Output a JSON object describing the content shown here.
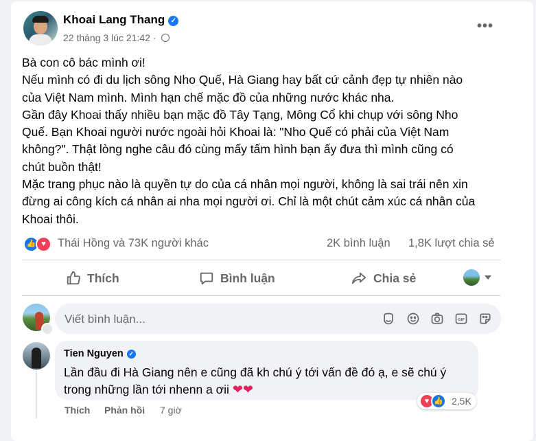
{
  "post": {
    "author": "Khoai Lang Thang",
    "timestamp": "22 tháng 3 lúc 21:42 ·",
    "privacy_icon": "globe-icon",
    "more_label": "•••",
    "lines": [
      "Bà con cô bác mình ơi!",
      "Nếu mình có đi du lịch sông Nho Quế, Hà Giang hay bất cứ cảnh đẹp tự nhiên nào",
      "của Việt Nam mình. Mình hạn chế mặc đồ của những nước khác nha.",
      "Gần đây Khoai thấy nhiều bạn mặc đồ Tây Tạng, Mông Cổ khi chụp với sông Nho",
      "Quế. Bạn Khoai người nước ngoài hỏi Khoai là: \"Nho Quế có phải của Việt Nam",
      "không?\". Thật lòng nghe câu đó cùng mấy tấm hình bạn ấy đưa thì mình cũng có",
      "chút buồn thật!",
      "Mặc trang phục nào là quyền tự do của cá nhân mọi người, không là sai trái nên xin",
      "đừng ai công kích cá nhân ai nha mọi người ơi. Chỉ là một chút cảm xúc cá nhân của",
      "Khoai thôi."
    ]
  },
  "stats": {
    "reactors": "Thái Hồng và 73K người khác",
    "comments": "2K bình luận",
    "shares": "1,8K lượt chia sẻ"
  },
  "actions": {
    "like": "Thích",
    "comment": "Bình luận",
    "share": "Chia sẻ"
  },
  "composer": {
    "placeholder": "Viết bình luận..."
  },
  "comment": {
    "author": "Tien Nguyen",
    "lines": [
      "Lần đầu đi Hà Giang nên e cũng đã kh chú ý tới vấn đề đó ạ, e sẽ chú ý",
      "trong những lần tới nhenn a ơii"
    ],
    "hearts": "❤❤",
    "reaction_count": "2,5K",
    "like_label": "Thích",
    "reply_label": "Phản hồi",
    "time": "7 giờ"
  },
  "colors": {
    "brand_blue": "#1877f2",
    "love_red": "#f33e58",
    "secondary_text": "#65676b"
  }
}
